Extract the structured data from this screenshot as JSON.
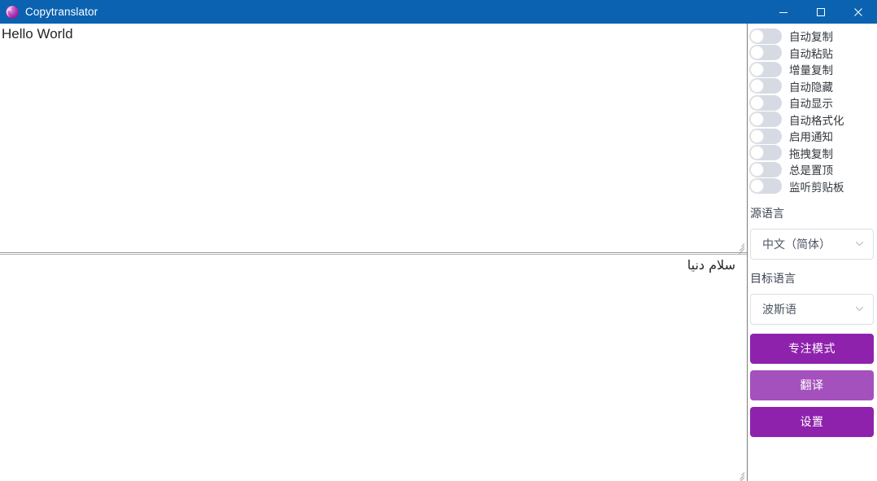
{
  "window": {
    "title": "Copytranslator",
    "icon": "app-logo-icon",
    "titlebar_color": "#0a62b0",
    "controls": {
      "minimize": "minimize-icon",
      "maximize": "maximize-icon",
      "close": "close-icon"
    }
  },
  "editor": {
    "source_text": "Hello World",
    "result_text": "سلام دنیا"
  },
  "sidebar": {
    "switches": [
      {
        "label": "自动复制",
        "on": false
      },
      {
        "label": "自动粘贴",
        "on": false
      },
      {
        "label": "增量复制",
        "on": false
      },
      {
        "label": "自动隐藏",
        "on": false
      },
      {
        "label": "自动显示",
        "on": false
      },
      {
        "label": "自动格式化",
        "on": false
      },
      {
        "label": "启用通知",
        "on": false
      },
      {
        "label": "拖拽复制",
        "on": false
      },
      {
        "label": "总是置顶",
        "on": false
      },
      {
        "label": "监听剪贴板",
        "on": false
      }
    ],
    "source_language": {
      "label": "源语言",
      "value": "中文（简体）",
      "caret": "chevron-down-icon"
    },
    "target_language": {
      "label": "目标语言",
      "value": "波斯语",
      "caret": "chevron-down-icon"
    },
    "buttons": {
      "focus_mode": "专注模式",
      "translate": "翻译",
      "settings": "设置"
    }
  },
  "colors": {
    "accent_purple": "#8e22ad",
    "accent_purple_hover": "#a451bd",
    "titlebar_blue": "#0a62b0",
    "switch_track_off": "#d6dbe3"
  }
}
